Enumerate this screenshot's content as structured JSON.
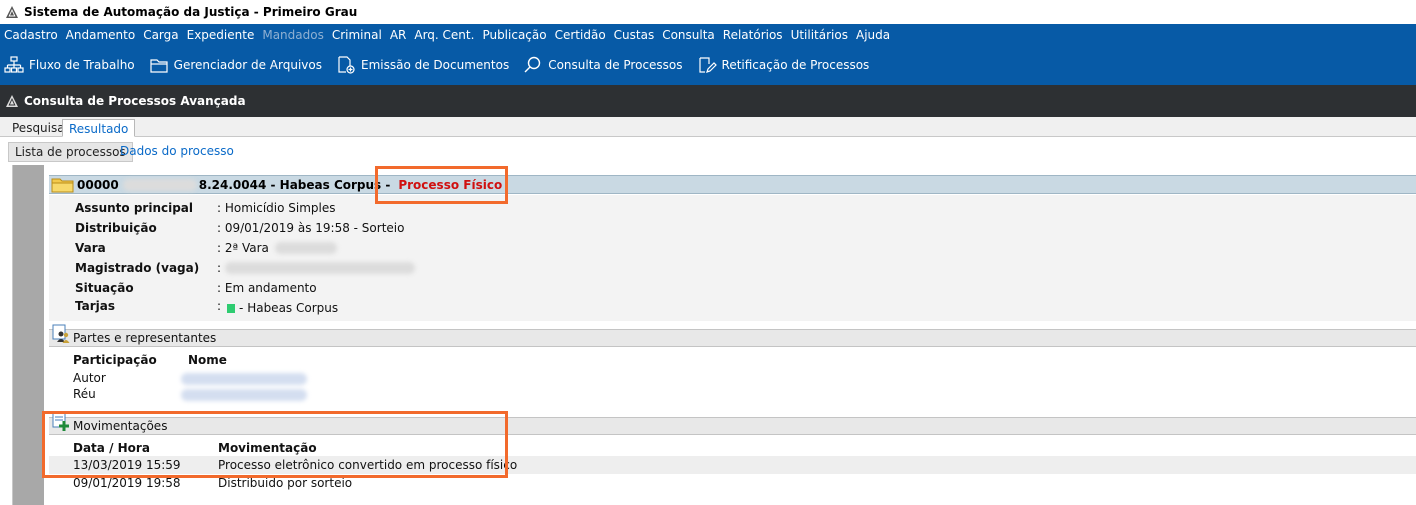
{
  "window": {
    "title": "Sistema de Automação da Justiça - Primeiro Grau"
  },
  "menu": {
    "items": [
      {
        "label": "Cadastro",
        "enabled": true
      },
      {
        "label": "Andamento",
        "enabled": true
      },
      {
        "label": "Carga",
        "enabled": true
      },
      {
        "label": "Expediente",
        "enabled": true
      },
      {
        "label": "Mandados",
        "enabled": false
      },
      {
        "label": "Criminal",
        "enabled": true
      },
      {
        "label": "AR",
        "enabled": true
      },
      {
        "label": "Arq. Cent.",
        "enabled": true
      },
      {
        "label": "Publicação",
        "enabled": true
      },
      {
        "label": "Certidão",
        "enabled": true
      },
      {
        "label": "Custas",
        "enabled": true
      },
      {
        "label": "Consulta",
        "enabled": true
      },
      {
        "label": "Relatórios",
        "enabled": true
      },
      {
        "label": "Utilitários",
        "enabled": true
      },
      {
        "label": "Ajuda",
        "enabled": true
      }
    ]
  },
  "toolbar": {
    "items": [
      {
        "label": "Fluxo de Trabalho",
        "icon": "workflow-icon"
      },
      {
        "label": "Gerenciador de Arquivos",
        "icon": "file-manager-icon"
      },
      {
        "label": "Emissão de Documentos",
        "icon": "document-add-icon"
      },
      {
        "label": "Consulta de Processos",
        "icon": "search-icon"
      },
      {
        "label": "Retificação de Processos",
        "icon": "edit-icon"
      }
    ]
  },
  "app_header": {
    "title": "Consulta de Processos Avançada"
  },
  "tabs": {
    "pesquisa": "Pesquisa",
    "resultado": "Resultado"
  },
  "subtabs": {
    "lista": "Lista de processos",
    "dados": "Dados do processo"
  },
  "process": {
    "number_prefix": "00000",
    "number_suffix": "8.24.0044 - Habeas Corpus -",
    "type_badge": "Processo Físico",
    "fields": [
      {
        "label": "Assunto principal",
        "value": ": Homicídio Simples"
      },
      {
        "label": "Distribuição",
        "value": ": 09/01/2019 às 19:58 - Sorteio"
      },
      {
        "label": "Vara",
        "value": ": 2ª Vara"
      },
      {
        "label": "Magistrado (vaga)",
        "value": ":"
      },
      {
        "label": "Situação",
        "value": ": Em andamento"
      },
      {
        "label": "Tarjas",
        "value": ":"
      }
    ],
    "tarja_text": "- Habeas Corpus",
    "tarja_color": "#2ecc71"
  },
  "partes": {
    "section_title": "Partes e representantes",
    "col_participacao": "Participação",
    "col_nome": "Nome",
    "rows": [
      {
        "participacao": "Autor"
      },
      {
        "participacao": "Réu"
      }
    ]
  },
  "movimentacoes": {
    "section_title": "Movimentações",
    "col_data": "Data / Hora",
    "col_mov": "Movimentação",
    "rows": [
      {
        "data": "13/03/2019 15:59",
        "mov": "Processo eletrônico convertido em processo físico"
      },
      {
        "data": "09/01/2019 19:58",
        "mov": "Distribuido por sorteio"
      }
    ]
  },
  "colors": {
    "menu_bg": "#075aa6",
    "header_bg": "#2d3033",
    "highlight": "#f26a2c",
    "badge_red": "#d01010"
  }
}
